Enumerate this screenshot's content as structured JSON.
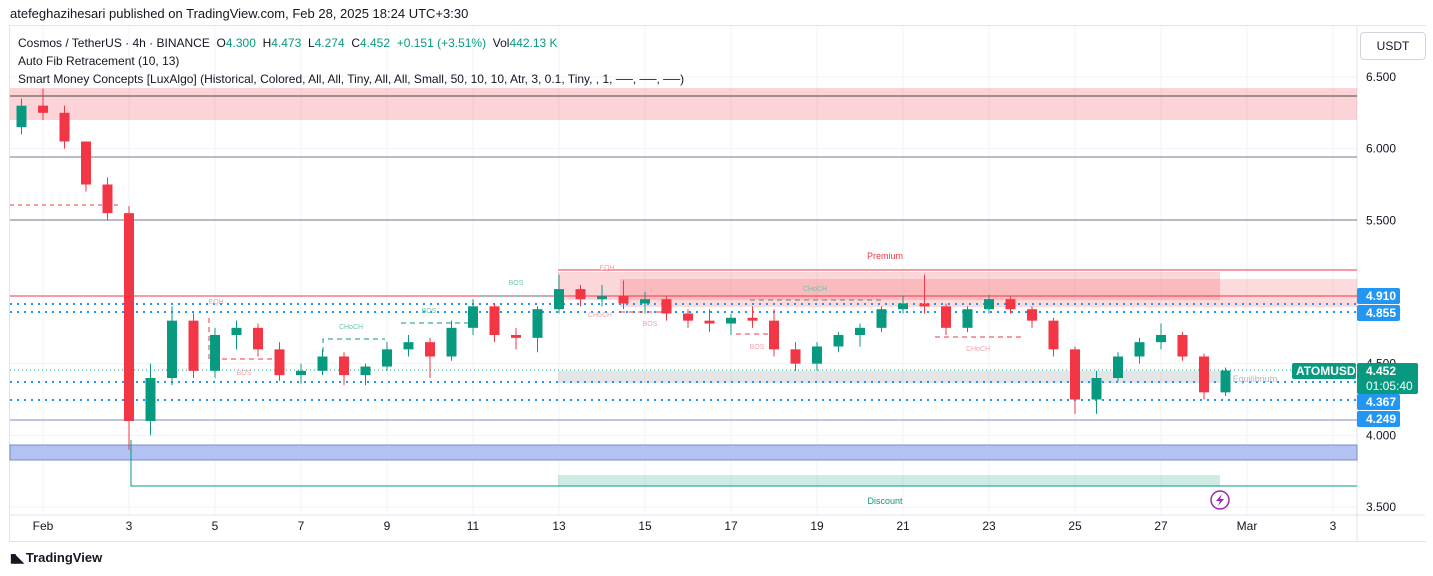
{
  "publisher_line": "atefeghazihesari published on TradingView.com, Feb 28, 2025 18:24 UTC+3:30",
  "legend": {
    "symbol": "Cosmos / TetherUS · 4h · BINANCE",
    "o_label": "O",
    "o": "4.300",
    "h_label": "H",
    "h": "4.473",
    "l_label": "L",
    "l": "4.274",
    "c_label": "C",
    "c": "4.452",
    "change": "+0.151 (+3.51%)",
    "vol_label": "Vol",
    "vol": "442.13 K",
    "indicator1": "Auto Fib Retracement (10, 13)",
    "indicator2": "Smart Money Concepts [LuxAlgo] (Historical, Colored, All, All, Tiny, All, All, Small, 50, 10, 10, Atr, 3, 0.1, Tiny, , 1, ──, ──, ──)"
  },
  "currency_button": "USDT",
  "footer": {
    "brand": "TradingView",
    "logo_icon": "tradingview-logo-icon"
  },
  "colors": {
    "up": "#089981",
    "down": "#f23645",
    "level_label": "#2196f3",
    "premium": "#f23645",
    "discount": "#089981",
    "fib_zone": "#b2c2f2"
  },
  "chart_labels": {
    "eqh1": "EQH",
    "bos1": "BOS",
    "choch1": "CHoCH",
    "bos2": "BOS",
    "bos3": "BOS",
    "eqh2": "EQH",
    "choch2": "CHoCH",
    "bos4": "BOS",
    "choch3": "CHoCH",
    "bos5": "BOS",
    "choch4": "CHoCH",
    "premium": "Premium",
    "discount": "Discount",
    "equilibrium": "Equilibrium"
  },
  "price_labels": {
    "l1": "4.910",
    "l2": "4.855",
    "symbol": "ATOMUSDT",
    "last": "4.452",
    "countdown": "01:05:40",
    "l3": "4.367",
    "l4": "4.249"
  },
  "chart_data": {
    "type": "candlestick",
    "title": "Cosmos / TetherUS · 4h · BINANCE",
    "ylim": [
      3.5,
      6.5
    ],
    "y_ticks": [
      "6.500",
      "6.000",
      "5.500",
      "4.500",
      "4.000",
      "3.500"
    ],
    "y_tick_values": [
      6.5,
      6.0,
      5.5,
      4.5,
      4.0,
      3.5
    ],
    "x_ticks": [
      "Feb",
      "3",
      "5",
      "7",
      "9",
      "11",
      "13",
      "15",
      "17",
      "19",
      "21",
      "23",
      "25",
      "27",
      "Mar",
      "3"
    ],
    "x_tick_days": [
      1,
      3,
      5,
      7,
      9,
      11,
      13,
      15,
      17,
      19,
      21,
      23,
      25,
      27,
      29,
      31
    ],
    "grid": true,
    "candle_start_day": 0.5,
    "candle_step_days": 0.5,
    "ohlc": [
      [
        6.15,
        6.35,
        6.1,
        6.3
      ],
      [
        6.3,
        6.42,
        6.2,
        6.25
      ],
      [
        6.25,
        6.3,
        6.0,
        6.05
      ],
      [
        6.05,
        6.05,
        5.7,
        5.75
      ],
      [
        5.75,
        5.8,
        5.5,
        5.55
      ],
      [
        5.55,
        5.6,
        3.9,
        4.1
      ],
      [
        4.1,
        4.5,
        4.0,
        4.4
      ],
      [
        4.4,
        4.9,
        4.35,
        4.8
      ],
      [
        4.8,
        4.85,
        4.4,
        4.45
      ],
      [
        4.45,
        4.75,
        4.4,
        4.7
      ],
      [
        4.7,
        4.8,
        4.6,
        4.75
      ],
      [
        4.75,
        4.78,
        4.55,
        4.6
      ],
      [
        4.6,
        4.65,
        4.38,
        4.42
      ],
      [
        4.42,
        4.5,
        4.36,
        4.45
      ],
      [
        4.45,
        4.6,
        4.42,
        4.55
      ],
      [
        4.55,
        4.58,
        4.35,
        4.42
      ],
      [
        4.42,
        4.5,
        4.35,
        4.48
      ],
      [
        4.48,
        4.65,
        4.45,
        4.6
      ],
      [
        4.6,
        4.7,
        4.55,
        4.65
      ],
      [
        4.65,
        4.68,
        4.4,
        4.55
      ],
      [
        4.55,
        4.8,
        4.52,
        4.75
      ],
      [
        4.75,
        4.95,
        4.7,
        4.9
      ],
      [
        4.9,
        4.92,
        4.65,
        4.7
      ],
      [
        4.7,
        4.75,
        4.6,
        4.68
      ],
      [
        4.68,
        4.9,
        4.58,
        4.88
      ],
      [
        4.88,
        5.12,
        4.85,
        5.02
      ],
      [
        5.02,
        5.05,
        4.9,
        4.95
      ],
      [
        4.95,
        5.05,
        4.9,
        4.97
      ],
      [
        4.97,
        5.08,
        4.88,
        4.92
      ],
      [
        4.92,
        5.0,
        4.85,
        4.95
      ],
      [
        4.95,
        4.97,
        4.8,
        4.85
      ],
      [
        4.85,
        4.88,
        4.75,
        4.8
      ],
      [
        4.8,
        4.88,
        4.72,
        4.78
      ],
      [
        4.78,
        4.85,
        4.7,
        4.82
      ],
      [
        4.82,
        4.9,
        4.75,
        4.8
      ],
      [
        4.8,
        4.88,
        4.55,
        4.6
      ],
      [
        4.6,
        4.65,
        4.45,
        4.5
      ],
      [
        4.5,
        4.65,
        4.45,
        4.62
      ],
      [
        4.62,
        4.72,
        4.58,
        4.7
      ],
      [
        4.7,
        4.78,
        4.62,
        4.75
      ],
      [
        4.75,
        4.9,
        4.72,
        4.88
      ],
      [
        4.88,
        4.97,
        4.85,
        4.92
      ],
      [
        4.92,
        5.12,
        4.85,
        4.9
      ],
      [
        4.9,
        4.92,
        4.7,
        4.75
      ],
      [
        4.75,
        4.9,
        4.72,
        4.88
      ],
      [
        4.88,
        4.98,
        4.85,
        4.95
      ],
      [
        4.95,
        4.97,
        4.85,
        4.88
      ],
      [
        4.88,
        4.9,
        4.75,
        4.8
      ],
      [
        4.8,
        4.82,
        4.55,
        4.6
      ],
      [
        4.6,
        4.62,
        4.15,
        4.25
      ],
      [
        4.25,
        4.45,
        4.15,
        4.4
      ],
      [
        4.4,
        4.58,
        4.38,
        4.55
      ],
      [
        4.55,
        4.68,
        4.5,
        4.65
      ],
      [
        4.65,
        4.78,
        4.6,
        4.7
      ],
      [
        4.7,
        4.72,
        4.52,
        4.55
      ],
      [
        4.55,
        4.57,
        4.25,
        4.3
      ],
      [
        4.3,
        4.473,
        4.274,
        4.452
      ]
    ],
    "levels": [
      4.91,
      4.855,
      4.367,
      4.249
    ]
  }
}
